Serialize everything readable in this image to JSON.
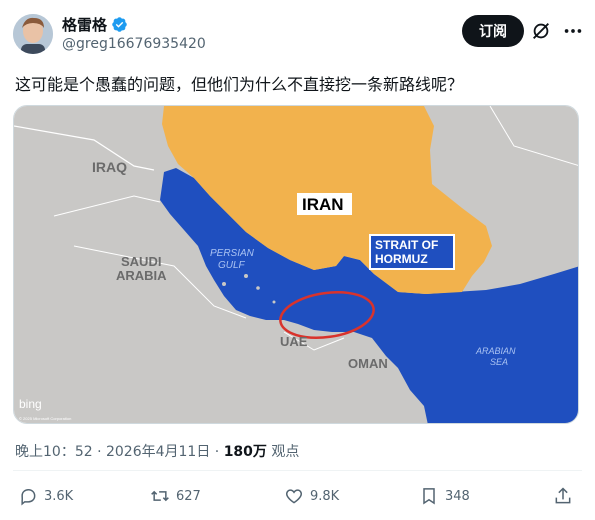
{
  "author": {
    "name": "格雷格",
    "handle": "@greg16676935420"
  },
  "header": {
    "subscribe_label": "订阅"
  },
  "tweet": {
    "text": "这可能是个愚蠢的问题，但他们为什么不直接挖一条新路线呢？"
  },
  "map": {
    "labels": {
      "iraq": "IRAQ",
      "iran": "IRAN",
      "persian_gulf_1": "PERSIAN",
      "persian_gulf_2": "GULF",
      "saudi_1": "SAUDI",
      "saudi_2": "ARABIA",
      "strait_1": "STRAIT OF",
      "strait_2": "HORMUZ",
      "uae": "UAE",
      "oman": "OMAN",
      "arabian_1": "ARABIAN",
      "arabian_2": "SEA",
      "watermark": "bing",
      "copyright": "© 2025 Microsoft Corporation"
    },
    "colors": {
      "land": "#c9c8c6",
      "iran": "#f2b24d",
      "water": "#1f4fbf",
      "circle": "#d9332c"
    }
  },
  "meta": {
    "time": "晚上10：52 · 2026年4月11日 · ",
    "views_count": "180万",
    "views_label": " 观点"
  },
  "actions": {
    "replies": "3.6K",
    "reposts": "627",
    "likes": "9.8K",
    "bookmarks": "348"
  },
  "icons": {
    "verified": "verified-badge-icon",
    "grok": "grok-icon",
    "more": "more-icon",
    "reply": "reply-icon",
    "repost": "repost-icon",
    "like": "heart-icon",
    "bookmark": "bookmark-icon",
    "share": "share-icon"
  }
}
